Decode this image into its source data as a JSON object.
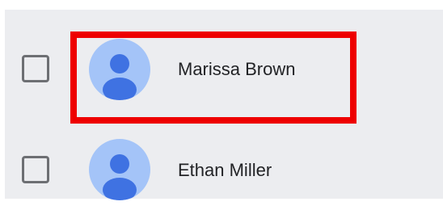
{
  "contacts": [
    {
      "name": "Marissa Brown",
      "avatar_icon": "person-icon",
      "checked": false,
      "highlighted": true
    },
    {
      "name": "Ethan Miller",
      "avatar_icon": "person-icon",
      "checked": false,
      "highlighted": false
    }
  ],
  "colors": {
    "panel_background": "#ecedf0",
    "avatar_background": "#a4c4f8",
    "avatar_figure": "#3f72e2",
    "highlight_border": "#ee0000",
    "checkbox_border": "#6d6f73"
  }
}
